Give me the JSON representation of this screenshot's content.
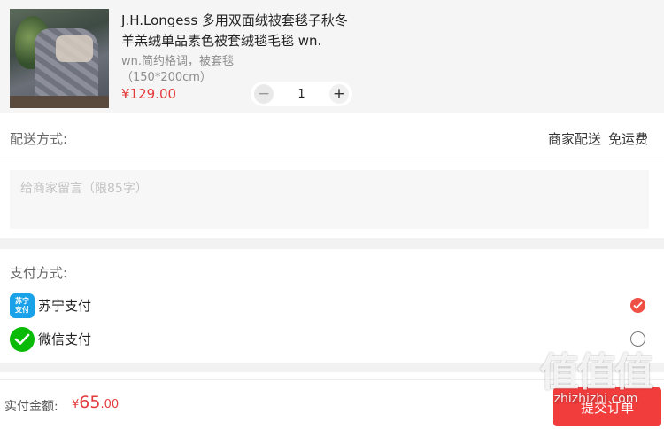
{
  "product": {
    "image_icon": "blanket-photo",
    "title": "J.H.Longess 多用双面绒被套毯子秋冬羊羔绒单品素色被套绒毯毛毯 wn.",
    "spec": "wn.简约格调，被套毯（150*200cm）",
    "price": "¥129.00",
    "quantity": "1",
    "minus_symbol": "−",
    "plus_symbol": "+"
  },
  "delivery": {
    "label": "配送方式:",
    "method": "商家配送",
    "fee": "免运费"
  },
  "memo": {
    "placeholder": "给商家留言（限85字）"
  },
  "payment": {
    "title": "支付方式:",
    "options": [
      {
        "label": "苏宁支付",
        "icon": "suning-pay-icon",
        "icon_text_1": "苏宁",
        "icon_text_2": "支付",
        "selected": true
      },
      {
        "label": "微信支付",
        "icon": "wechat-pay-icon",
        "selected": false
      }
    ]
  },
  "footer": {
    "total_label": "实付金额:",
    "currency": "¥",
    "total_integer": "65",
    "total_decimal": ".00",
    "submit_label": "提交订单"
  },
  "watermark": {
    "big": "值值值",
    "small": "zhizhizhi.com"
  },
  "colors": {
    "accent": "#e4393c",
    "submit": "#f23d3d",
    "radio_selected": "#f04f43",
    "suning": "#1aa2e8",
    "wechat": "#09bb07"
  }
}
